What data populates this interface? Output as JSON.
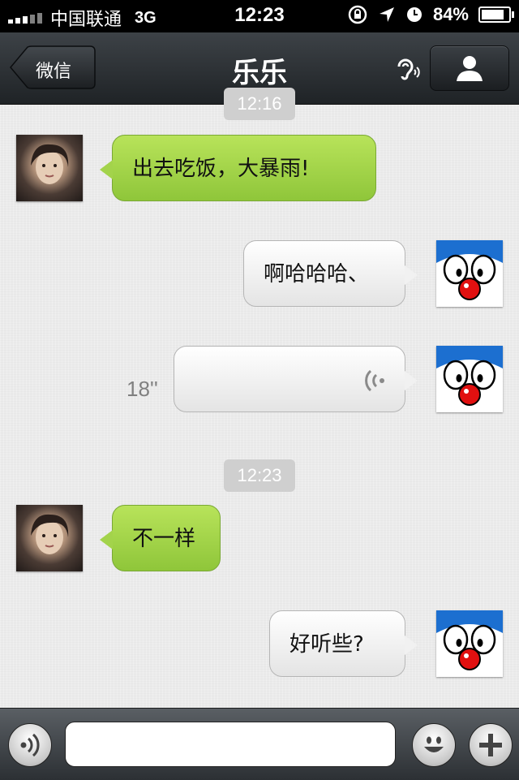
{
  "status_bar": {
    "carrier": "中国联通",
    "network": "3G",
    "time": "12:23",
    "battery": "84%",
    "battery_level": 0.84
  },
  "nav": {
    "back_label": "微信",
    "title": "乐乐"
  },
  "messages": [
    {
      "type": "timestamp",
      "text": "12:16"
    },
    {
      "type": "text",
      "from": "other",
      "text": "出去吃饭，大暴雨!"
    },
    {
      "type": "text",
      "from": "me",
      "text": "啊哈哈哈、"
    },
    {
      "type": "voice",
      "from": "me",
      "duration": "18''"
    },
    {
      "type": "timestamp",
      "text": "12:23"
    },
    {
      "type": "text",
      "from": "other",
      "text": "不一样"
    },
    {
      "type": "text",
      "from": "me",
      "text": "好听些?"
    }
  ],
  "input_bar": {
    "placeholder": ""
  },
  "colors": {
    "incoming_bubble": "#a3d34b",
    "outgoing_bubble": "#f1f1f1",
    "nav_bar": "#2b2f33"
  },
  "icons": {
    "ear": "ear-speaker-icon",
    "profile": "person-icon",
    "voice": "voice-wave-icon",
    "emoji": "smiley-icon",
    "plus": "plus-icon"
  }
}
